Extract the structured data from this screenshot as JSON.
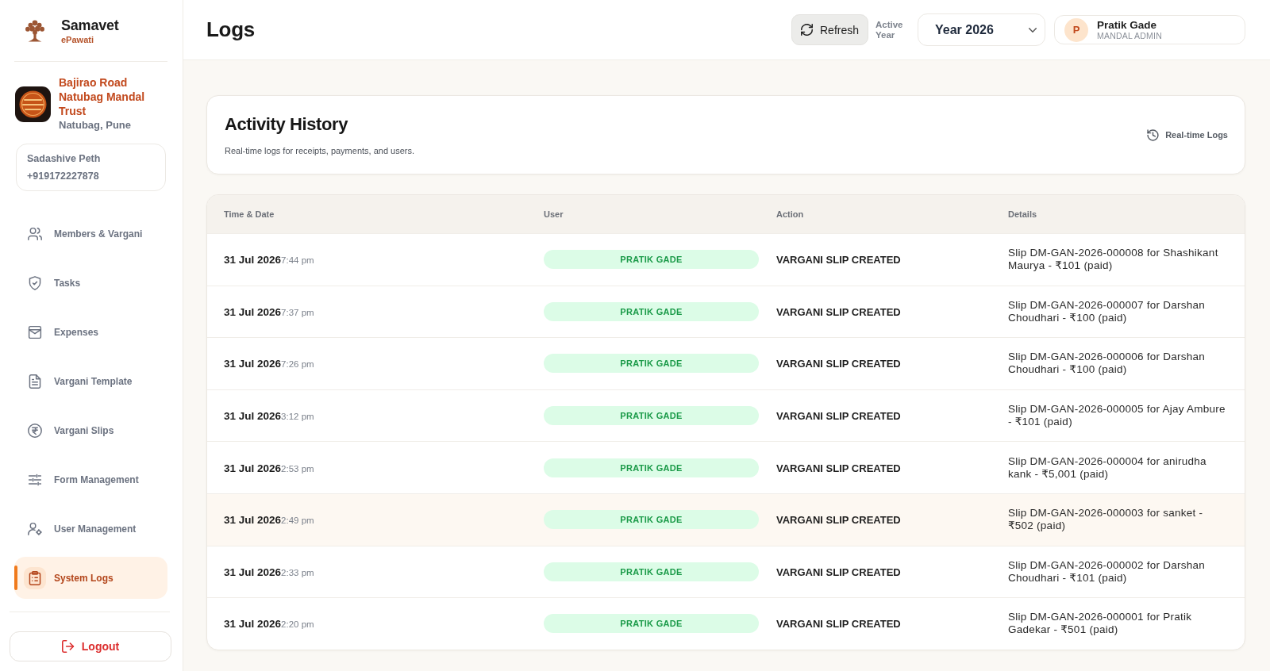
{
  "sidebar": {
    "brand": {
      "name": "Samavet",
      "tagline": "ePawati"
    },
    "organization": {
      "name": "Bajirao Road Natubag Mandal Trust",
      "location": "Natubag, Pune"
    },
    "contact": {
      "area": "Sadashive Peth",
      "phone": "+919172227878"
    },
    "nav_items": [
      {
        "label": "Members & Vargani",
        "selected": false
      },
      {
        "label": "Tasks",
        "selected": false
      },
      {
        "label": "Expenses",
        "selected": false
      },
      {
        "label": "Vargani Template",
        "selected": false
      },
      {
        "label": "Vargani Slips",
        "selected": false
      },
      {
        "label": "Form Management",
        "selected": false
      },
      {
        "label": "User Management",
        "selected": false
      },
      {
        "label": "System Logs",
        "selected": true
      }
    ],
    "logout": {
      "label": "Logout"
    }
  },
  "header": {
    "title": "Logs",
    "refresh_button": {
      "label": "Refresh"
    },
    "active_year": {
      "label": "Active Year",
      "value": "Year 2026"
    },
    "user": {
      "initial": "P",
      "name": "Pratik Gade",
      "role": "MANDAL ADMIN"
    }
  },
  "activity_history": {
    "title": "Activity History",
    "subtitle": "Real-time logs for receipts, payments, and users.",
    "indicator": "Real-time Logs"
  },
  "table": {
    "columns": [
      "Time & Date",
      "User",
      "Action",
      "Details"
    ],
    "rows": [
      {
        "date": "31 Jul 2026",
        "time": "7:44 pm",
        "user": "PRATIK GADE",
        "action": "VARGANI SLIP CREATED",
        "details": "Slip DM-GAN-2026-000008 for Shashikant Maurya - ₹101 (paid)",
        "selected": false
      },
      {
        "date": "31 Jul 2026",
        "time": "7:37 pm",
        "user": "PRATIK GADE",
        "action": "VARGANI SLIP CREATED",
        "details": "Slip DM-GAN-2026-000007 for Darshan Choudhari - ₹100 (paid)",
        "selected": false
      },
      {
        "date": "31 Jul 2026",
        "time": "7:26 pm",
        "user": "PRATIK GADE",
        "action": "VARGANI SLIP CREATED",
        "details": "Slip DM-GAN-2026-000006 for Darshan Choudhari - ₹100 (paid)",
        "selected": false
      },
      {
        "date": "31 Jul 2026",
        "time": "3:12 pm",
        "user": "PRATIK GADE",
        "action": "VARGANI SLIP CREATED",
        "details": "Slip DM-GAN-2026-000005 for Ajay Ambure - ₹101 (paid)",
        "selected": false
      },
      {
        "date": "31 Jul 2026",
        "time": "2:53 pm",
        "user": "PRATIK GADE",
        "action": "VARGANI SLIP CREATED",
        "details": "Slip DM-GAN-2026-000004 for anirudha kank - ₹5,001 (paid)",
        "selected": false
      },
      {
        "date": "31 Jul 2026",
        "time": "2:49 pm",
        "user": "PRATIK GADE",
        "action": "VARGANI SLIP CREATED",
        "details": "Slip DM-GAN-2026-000003 for sanket - ₹502 (paid)",
        "selected": true
      },
      {
        "date": "31 Jul 2026",
        "time": "2:33 pm",
        "user": "PRATIK GADE",
        "action": "VARGANI SLIP CREATED",
        "details": "Slip DM-GAN-2026-000002 for Darshan Choudhari - ₹101 (paid)",
        "selected": false
      },
      {
        "date": "31 Jul 2026",
        "time": "2:20 pm",
        "user": "PRATIK GADE",
        "action": "VARGANI SLIP CREATED",
        "details": "Slip DM-GAN-2026-000001 for Pratik Gadekar - ₹501 (paid)",
        "selected": false
      }
    ]
  }
}
